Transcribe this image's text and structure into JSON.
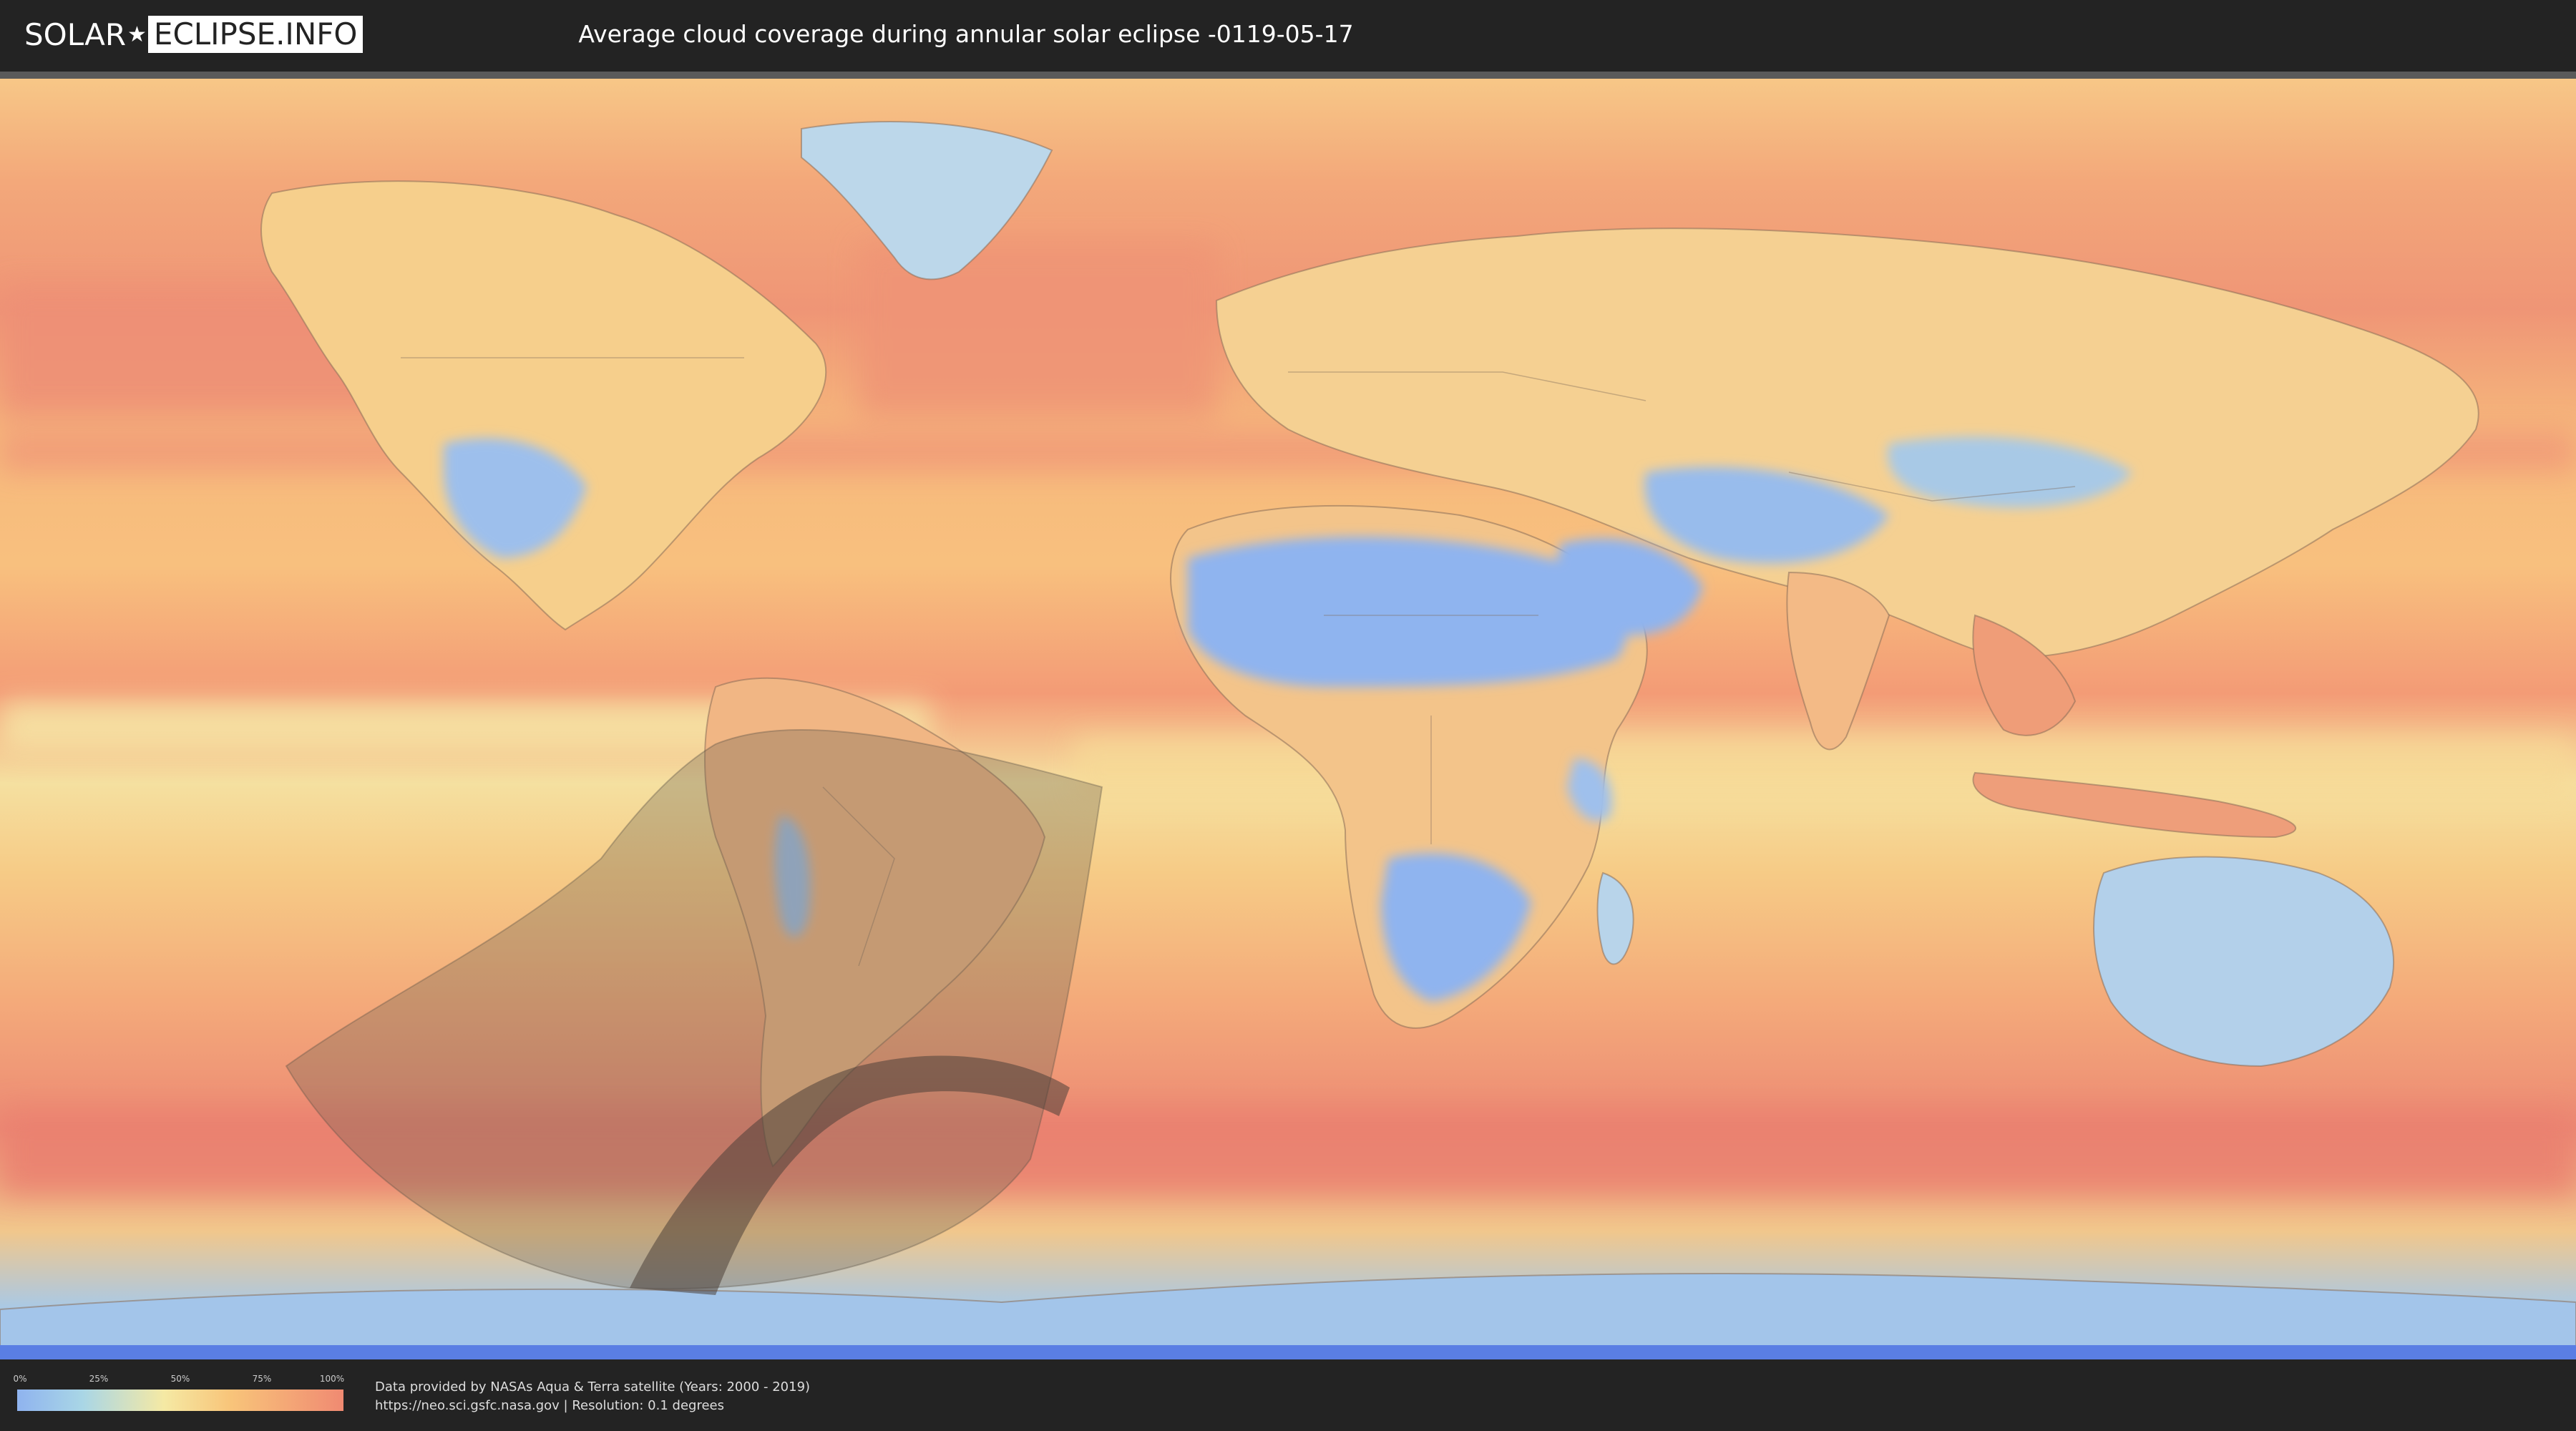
{
  "header": {
    "logo": {
      "part1": "SOLAR",
      "part2": "ECLIPSE.INFO"
    },
    "title": "Average cloud coverage during annular solar eclipse -0119-05-17"
  },
  "map": {
    "type": "cloud-coverage-world-map",
    "projection": "equirectangular",
    "colors": {
      "clear": "#8fb3ef",
      "low": "#a9d6e6",
      "mid": "#f5e9a4",
      "high": "#f8c57a",
      "overcast": "#f08a72",
      "eclipse_shadow": "#7a6a50",
      "annular_path": "#5e4f44"
    }
  },
  "legend": {
    "ticks": [
      "0%",
      "25%",
      "50%",
      "75%",
      "100%"
    ],
    "tick_values": [
      0,
      25,
      50,
      75,
      100
    ]
  },
  "footer": {
    "line1": "Data provided by NASAs Aqua & Terra satellite (Years: 2000 - 2019)",
    "line2": "https://neo.sci.gsfc.nasa.gov | Resolution: 0.1 degrees"
  }
}
